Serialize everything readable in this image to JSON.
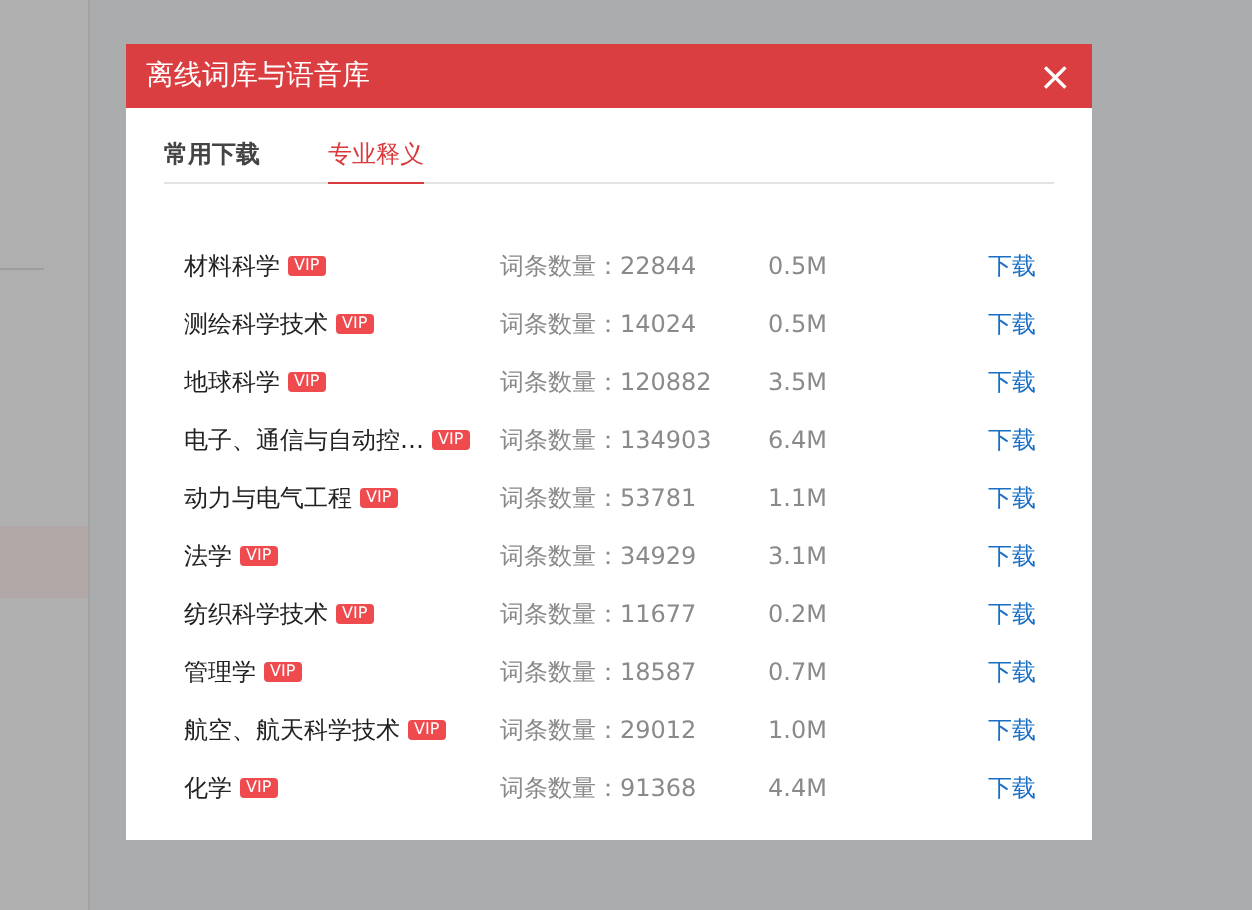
{
  "dialog": {
    "title": "离线词库与语音库",
    "close": "×"
  },
  "tabs": [
    {
      "label": "常用下载",
      "selected": false
    },
    {
      "label": "专业释义",
      "selected": true
    }
  ],
  "rows": [
    {
      "name": "材料科学",
      "badge": "VIP",
      "count": "词条数量：22844",
      "size": "0.5M",
      "action": "下载"
    },
    {
      "name": "测绘科学技术",
      "badge": "VIP",
      "count": "词条数量：14024",
      "size": "0.5M",
      "action": "下载"
    },
    {
      "name": "地球科学",
      "badge": "VIP",
      "count": "词条数量：120882",
      "size": "3.5M",
      "action": "下载"
    },
    {
      "name": "电子、通信与自动控…",
      "badge": "VIP",
      "count": "词条数量：134903",
      "size": "6.4M",
      "action": "下载"
    },
    {
      "name": "动力与电气工程",
      "badge": "VIP",
      "count": "词条数量：53781",
      "size": "1.1M",
      "action": "下载"
    },
    {
      "name": "法学",
      "badge": "VIP",
      "count": "词条数量：34929",
      "size": "3.1M",
      "action": "下载"
    },
    {
      "name": "纺织科学技术",
      "badge": "VIP",
      "count": "词条数量：11677",
      "size": "0.2M",
      "action": "下载"
    },
    {
      "name": "管理学",
      "badge": "VIP",
      "count": "词条数量：18587",
      "size": "0.7M",
      "action": "下载"
    },
    {
      "name": "航空、航天科学技术",
      "badge": "VIP",
      "count": "词条数量：29012",
      "size": "1.0M",
      "action": "下载"
    },
    {
      "name": "化学",
      "badge": "VIP",
      "count": "词条数量：91368",
      "size": "4.4M",
      "action": "下载"
    }
  ]
}
